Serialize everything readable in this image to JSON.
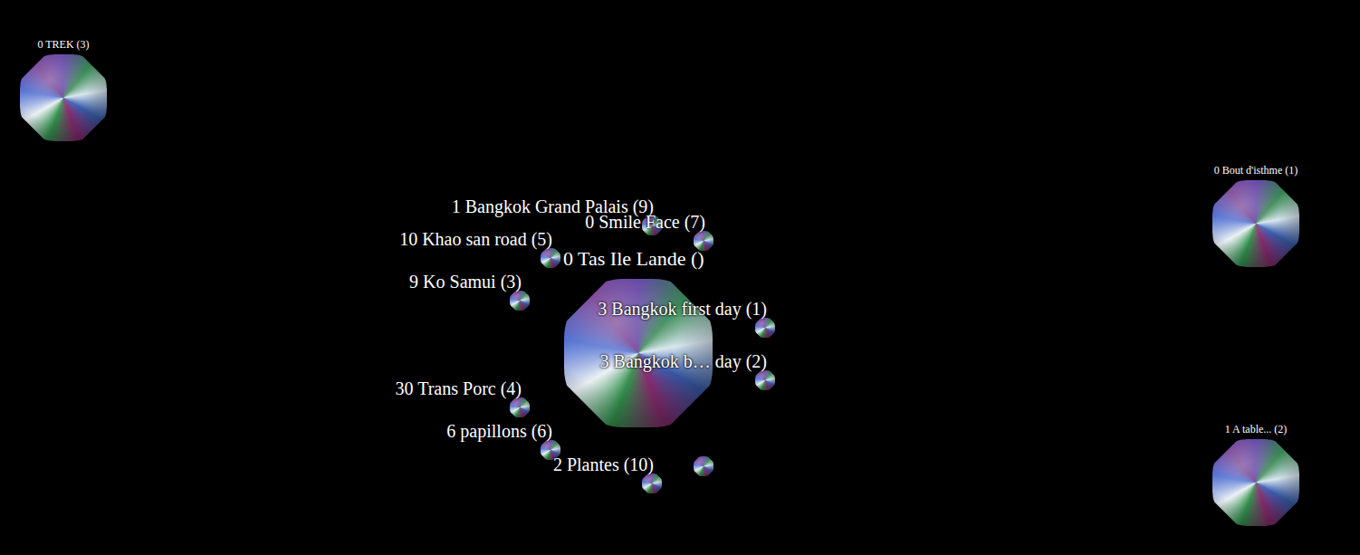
{
  "scene": {
    "title": "0 Tas Ile Lande ()"
  },
  "albums": [
    {
      "label": "1 Bangkok Grand Palais (9)"
    },
    {
      "label": "0 Smile Face (7)"
    },
    {
      "label": "10 Khao san road (5)"
    },
    {
      "label": "9 Ko Samui (3)"
    },
    {
      "label": "3 Bangkok first day (1)"
    },
    {
      "label": "3 Bangkok b… day (2)"
    },
    {
      "label": "30 Trans Porc (4)"
    },
    {
      "label": "6 papillons (6)"
    },
    {
      "label": "2 Plantes (10)"
    },
    {
      "label": ""
    }
  ],
  "corner_albums": [
    {
      "label": "0 TREK (3)"
    },
    {
      "label": "0 Bout d'isthme (1)"
    },
    {
      "label": "1 A table... (2)"
    }
  ]
}
